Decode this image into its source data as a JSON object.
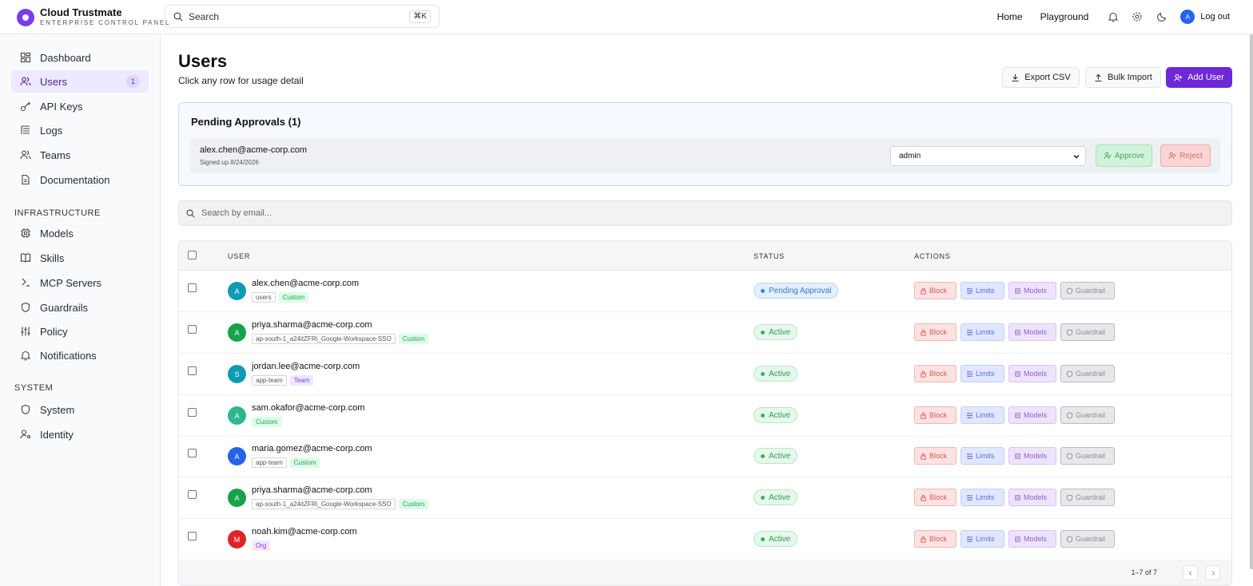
{
  "brand": {
    "title": "Cloud Trustmate",
    "subtitle": "ENTERPRISE CONTROL PANEL"
  },
  "topbar": {
    "search_placeholder": "Search",
    "search_shortcut": "⌘K",
    "links": [
      "Home",
      "Playground"
    ],
    "user_initial": "A",
    "logout_label": "Log out"
  },
  "sidebar": {
    "items": [
      {
        "label": "Dashboard",
        "icon": "dashboard-icon"
      },
      {
        "label": "Users",
        "icon": "users-icon",
        "badge": "1",
        "active": true
      },
      {
        "label": "API Keys",
        "icon": "key-icon"
      },
      {
        "label": "Logs",
        "icon": "logs-icon"
      },
      {
        "label": "Teams",
        "icon": "teams-icon"
      },
      {
        "label": "Documentation",
        "icon": "document-icon"
      }
    ],
    "infra_label": "INFRASTRUCTURE",
    "infra_items": [
      {
        "label": "Models",
        "icon": "chip-icon"
      },
      {
        "label": "Skills",
        "icon": "book-icon"
      },
      {
        "label": "MCP Servers",
        "icon": "server-icon"
      },
      {
        "label": "Guardrails",
        "icon": "shield-icon"
      },
      {
        "label": "Policy",
        "icon": "sliders-icon"
      },
      {
        "label": "Notifications",
        "icon": "bell-icon"
      }
    ],
    "system_label": "SYSTEM",
    "system_items": [
      {
        "label": "System",
        "icon": "shield-icon"
      },
      {
        "label": "Identity",
        "icon": "identity-icon"
      }
    ]
  },
  "page": {
    "title": "Users",
    "subtitle": "Click any row for usage detail",
    "export_label": "Export CSV",
    "import_label": "Bulk Import",
    "add_label": "Add User"
  },
  "pending": {
    "title": "Pending Approvals (1)",
    "email": "alex.chen@acme-corp.com",
    "signed_up": "Signed up 8/24/2026",
    "role_value": "admin",
    "approve_label": "Approve",
    "reject_label": "Reject"
  },
  "email_search_placeholder": "Search by email...",
  "table": {
    "headers": {
      "user": "USER",
      "status": "STATUS",
      "actions": "ACTIONS"
    },
    "action_labels": {
      "block": "Block",
      "limits": "Limits",
      "models": "Models",
      "guardrail": "Guardrail"
    },
    "rows": [
      {
        "initial": "A",
        "avatar_color": "#0e9bb5",
        "email": "alex.chen@acme-corp.com",
        "tags": [
          {
            "text": "users",
            "kind": "plain"
          },
          {
            "text": "Custom",
            "kind": "custom"
          }
        ],
        "status": "Pending Approval",
        "status_kind": "pending"
      },
      {
        "initial": "A",
        "avatar_color": "#16a34a",
        "email": "priya.sharma@acme-corp.com",
        "tags": [
          {
            "text": "ap-south-1_a24itZFRi_Google-Workspace-SSO",
            "kind": "plain"
          },
          {
            "text": "Custom",
            "kind": "custom"
          }
        ],
        "status": "Active",
        "status_kind": "active"
      },
      {
        "initial": "S",
        "avatar_color": "#0e9bb5",
        "email": "jordan.lee@acme-corp.com",
        "tags": [
          {
            "text": "app-team",
            "kind": "plain"
          },
          {
            "text": "Team",
            "kind": "team"
          }
        ],
        "status": "Active",
        "status_kind": "active"
      },
      {
        "initial": "A",
        "avatar_color": "#2fb58f",
        "email": "sam.okafor@acme-corp.com",
        "tags": [
          {
            "text": "Custom",
            "kind": "custom"
          }
        ],
        "status": "Active",
        "status_kind": "active"
      },
      {
        "initial": "A",
        "avatar_color": "#2563eb",
        "email": "maria.gomez@acme-corp.com",
        "tags": [
          {
            "text": "app-team",
            "kind": "plain"
          },
          {
            "text": "Custom",
            "kind": "custom"
          }
        ],
        "status": "Active",
        "status_kind": "active"
      },
      {
        "initial": "A",
        "avatar_color": "#16a34a",
        "email": "priya.sharma@acme-corp.com",
        "tags": [
          {
            "text": "ap-south-1_a24itZFRi_Google-Workspace-SSO",
            "kind": "plain"
          },
          {
            "text": "Custom",
            "kind": "custom"
          }
        ],
        "status": "Active",
        "status_kind": "active"
      },
      {
        "initial": "M",
        "avatar_color": "#dc2626",
        "email": "noah.kim@acme-corp.com",
        "tags": [
          {
            "text": "Org",
            "kind": "org"
          }
        ],
        "status": "Active",
        "status_kind": "active"
      }
    ],
    "pagination": "1–7 of 7"
  },
  "colors": {
    "accent": "#6d28d9",
    "active_nav_bg": "#ede9fe",
    "pending_border": "#c7d8f5"
  }
}
